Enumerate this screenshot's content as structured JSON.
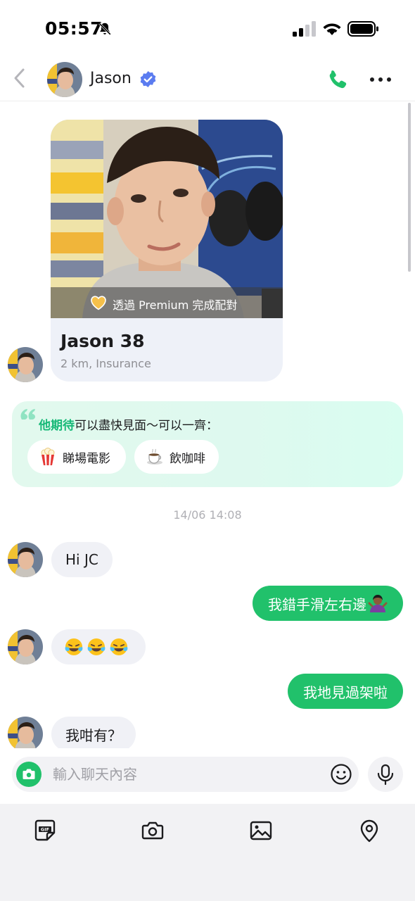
{
  "status_bar": {
    "time": "05:57"
  },
  "header": {
    "contact_name": "Jason"
  },
  "profile_card": {
    "premium_label": "透過 Premium 完成配對",
    "name_age": "Jason 38",
    "details": "2 km, Insurance"
  },
  "expectation": {
    "highlight": "他期待",
    "text": "可以盡快見面～可以一齊：",
    "chips": [
      {
        "icon": "popcorn-icon",
        "label": "睇場電影"
      },
      {
        "icon": "coffee-icon",
        "label": "飲咖啡"
      }
    ]
  },
  "chat": {
    "timestamp": "14/06 14:08",
    "messages": [
      {
        "direction": "incoming",
        "text": "Hi JC"
      },
      {
        "direction": "outgoing",
        "text": "我錯手滑左右邊",
        "emoji": "woman-shrugging"
      },
      {
        "direction": "incoming",
        "text": "",
        "emoji": "tears-of-joy x3"
      },
      {
        "direction": "outgoing",
        "text": "我地見過架啦"
      },
      {
        "direction": "incoming",
        "text": "我咁有？"
      }
    ]
  },
  "composer": {
    "placeholder": "輸入聊天內容"
  },
  "toolbar": {
    "items": [
      "gif-icon",
      "camera-icon",
      "image-icon",
      "location-icon"
    ]
  },
  "colors": {
    "accent_green": "#21c16b",
    "verified_blue": "#5b7cf0",
    "incoming_bubble": "#f0f1f6",
    "highlight_green": "#17b978"
  }
}
